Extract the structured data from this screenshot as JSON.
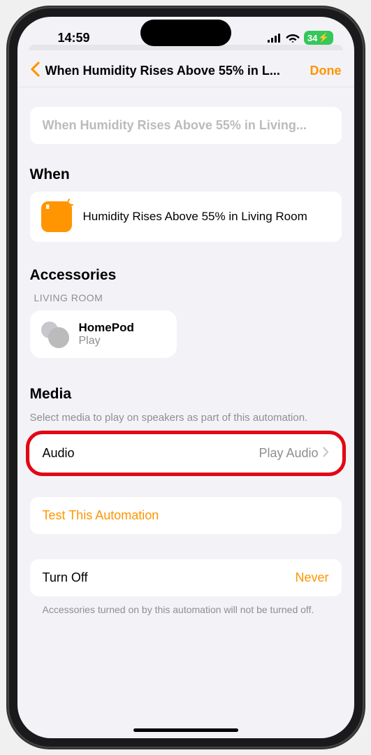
{
  "statusbar": {
    "time": "14:59",
    "battery": "34"
  },
  "nav": {
    "title": "When Humidity Rises Above 55% in L...",
    "done": "Done"
  },
  "name_input": {
    "placeholder": "When Humidity Rises Above 55% in Living..."
  },
  "when": {
    "header": "When",
    "condition": "Humidity Rises Above 55% in Living Room"
  },
  "accessories": {
    "header": "Accessories",
    "room": "LIVING ROOM",
    "device_name": "HomePod",
    "device_status": "Play"
  },
  "media": {
    "header": "Media",
    "subtext": "Select media to play on speakers as part of this automation.",
    "label": "Audio",
    "value": "Play Audio"
  },
  "test": {
    "label": "Test This Automation"
  },
  "turnoff": {
    "label": "Turn Off",
    "value": "Never",
    "footer": "Accessories turned on by this automation will not be turned off."
  }
}
